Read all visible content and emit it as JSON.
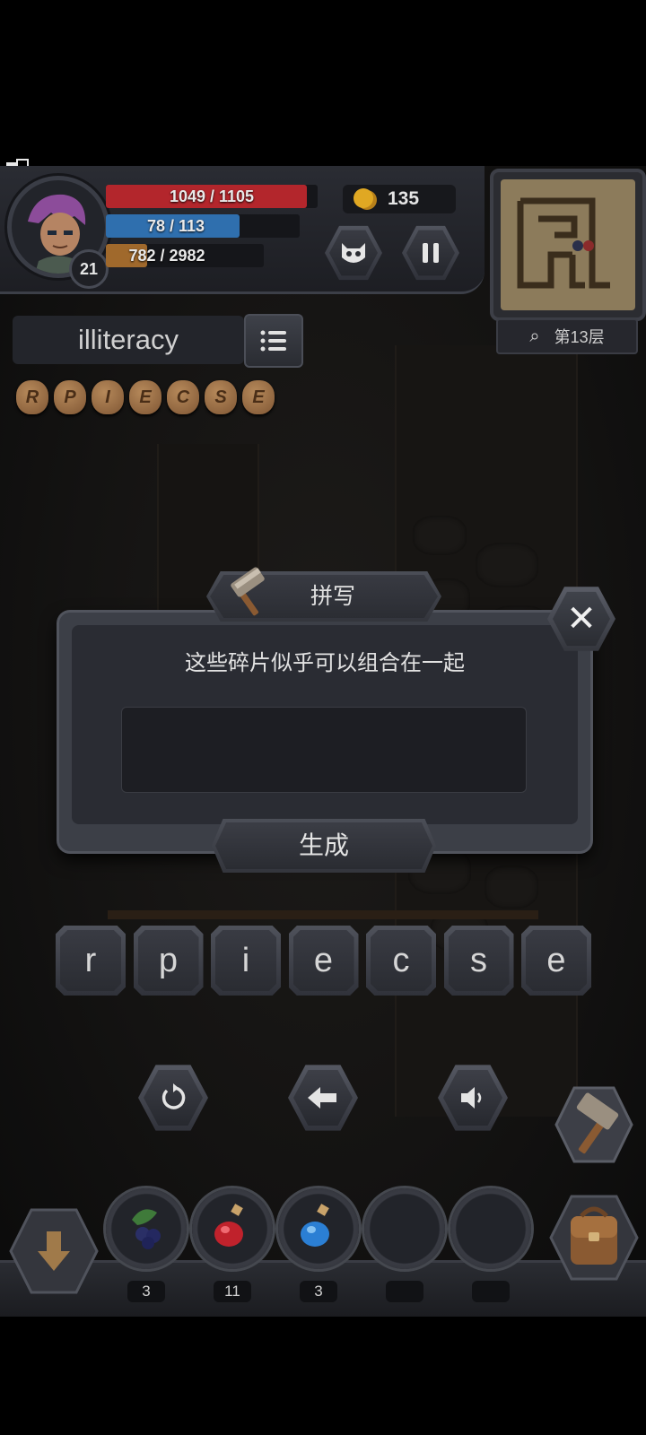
{
  "hud": {
    "hp_text": "1049 / 1105",
    "hp_fraction": 0.949,
    "mp_text": "78 / 113",
    "mp_fraction": 0.69,
    "xp_text": "782 / 2982",
    "xp_fraction": 0.262,
    "level": "21",
    "gold": "135",
    "floor_label": "第13层"
  },
  "word": {
    "current_word": "illiteracy",
    "fragments": [
      "R",
      "P",
      "I",
      "E",
      "C",
      "S",
      "E"
    ]
  },
  "dialog": {
    "title": "拼写",
    "message": "这些碎片似乎可以组合在一起",
    "input_value": "",
    "generate_label": "生成",
    "close_symbol": "✕"
  },
  "letters": [
    "r",
    "p",
    "i",
    "e",
    "c",
    "s",
    "e"
  ],
  "controls": {
    "reset_icon": "reset-icon",
    "backspace_icon": "backspace-arrow-icon",
    "sound_icon": "speaker-icon"
  },
  "inventory": {
    "slots": [
      {
        "name": "berries",
        "count": "3"
      },
      {
        "name": "red-potion",
        "count": "11"
      },
      {
        "name": "blue-potion",
        "count": "3"
      },
      {
        "name": "empty",
        "count": ""
      },
      {
        "name": "empty",
        "count": ""
      }
    ]
  },
  "colors": {
    "hp": "#b3262c",
    "mp": "#2f6fae",
    "xp": "#a0692c",
    "gold": "#e0a823"
  }
}
